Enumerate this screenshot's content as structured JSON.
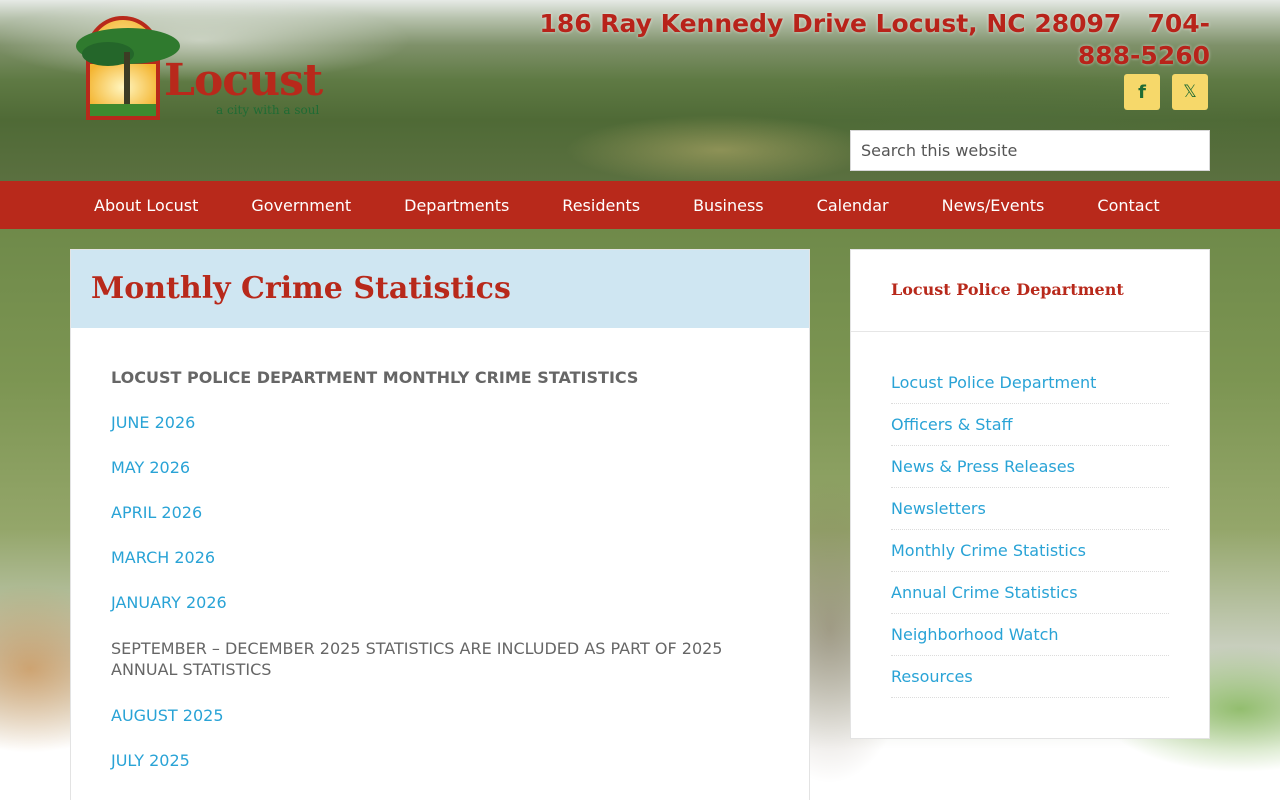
{
  "header": {
    "logo_text": "Locust",
    "logo_tagline": "a city with a soul",
    "address": "186 Ray Kennedy Drive Locust, NC 28097",
    "phone": "704-888-5260",
    "social": [
      {
        "name": "facebook",
        "glyph": "f"
      },
      {
        "name": "x",
        "glyph": "𝕏"
      }
    ],
    "search_placeholder": "Search this website"
  },
  "nav": {
    "items": [
      {
        "label": "About Locust"
      },
      {
        "label": "Government"
      },
      {
        "label": "Departments"
      },
      {
        "label": "Residents"
      },
      {
        "label": "Business"
      },
      {
        "label": "Calendar"
      },
      {
        "label": "News/Events"
      },
      {
        "label": "Contact"
      }
    ]
  },
  "main": {
    "title": "Monthly Crime Statistics",
    "section_title": "LOCUST POLICE DEPARTMENT MONTHLY CRIME STATISTICS",
    "links_a": [
      {
        "label": "JUNE 2026"
      },
      {
        "label": "MAY 2026"
      },
      {
        "label": "APRIL 2026"
      },
      {
        "label": "MARCH 2026"
      },
      {
        "label": "JANUARY 2026"
      }
    ],
    "note": "SEPTEMBER – DECEMBER 2025 STATISTICS ARE INCLUDED AS PART OF 2025 ANNUAL STATISTICS",
    "links_b": [
      {
        "label": "AUGUST 2025"
      },
      {
        "label": "JULY 2025"
      }
    ]
  },
  "sidebar": {
    "title": "Locust Police Department",
    "items": [
      {
        "label": "Locust Police Department"
      },
      {
        "label": "Officers & Staff"
      },
      {
        "label": "News & Press Releases"
      },
      {
        "label": "Newsletters"
      },
      {
        "label": "Monthly Crime Statistics"
      },
      {
        "label": "Annual Crime Statistics"
      },
      {
        "label": "Neighborhood Watch"
      },
      {
        "label": "Resources"
      }
    ]
  },
  "colors": {
    "brand_red": "#b8291b",
    "link_blue": "#29a3d6",
    "title_bg": "#cfe6f2",
    "social_yellow": "#f6d86a"
  }
}
